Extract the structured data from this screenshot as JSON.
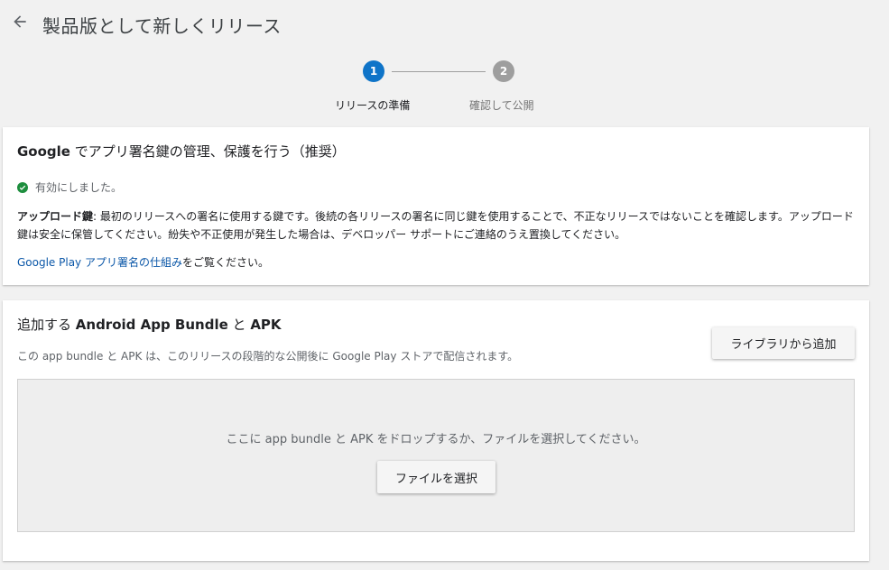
{
  "header": {
    "title": "製品版として新しくリリース",
    "back_icon": "arrow-back-icon"
  },
  "stepper": {
    "steps": [
      {
        "number": "1",
        "label": "リリースの準備",
        "active": true,
        "color": "#0f74c8"
      },
      {
        "number": "2",
        "label": "確認して公開",
        "active": false,
        "color": "#9e9e9e"
      }
    ]
  },
  "signing_card": {
    "title_bold": "Google",
    "title_rest": " でアプリ署名鍵の管理、保護を行う（推奨）",
    "status": "有効にしました。",
    "status_color": "#1e8e3e",
    "upload_key_term": "アップロード鍵",
    "description": ": 最初のリリースへの署名に使用する鍵です。後続の各リリースの署名に同じ鍵を使用することで、不正なリリースではないことを確認します。アップロード鍵は安全に保管してください。紛失や不正使用が発生した場合は、デベロッパー サポートにご連絡のうえ置換してください。",
    "link_text": "Google Play アプリ署名の仕組み",
    "link_suffix": "をご覧ください。",
    "link_color": "#0b57a8"
  },
  "bundle_card": {
    "title_prefix": "追加する ",
    "title_bold": "Android App Bundle",
    "title_mid": " と ",
    "title_bold2": "APK",
    "subtitle": "この app bundle と APK は、このリリースの段階的な公開後に Google Play ストアで配信されます。",
    "library_button": "ライブラリから追加",
    "drop_text": "ここに app bundle と APK をドロップするか、ファイルを選択してください。",
    "choose_file_button": "ファイルを選択"
  }
}
